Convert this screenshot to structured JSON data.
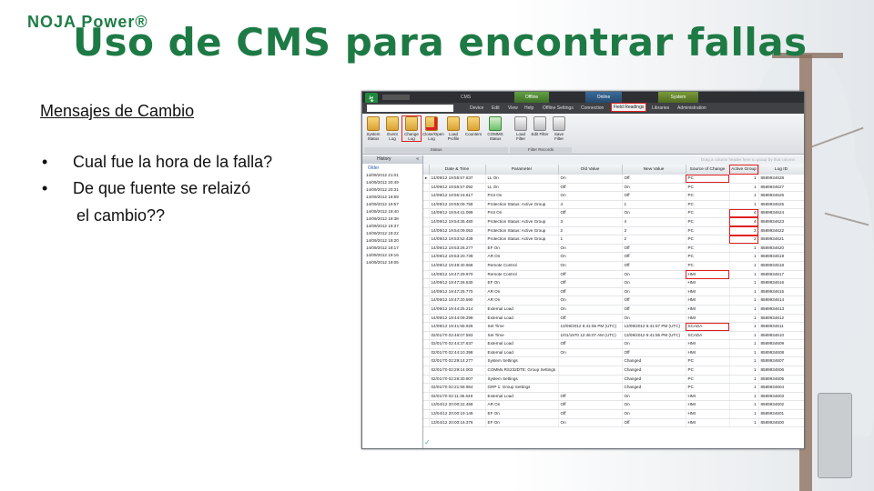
{
  "header": {
    "logo_text": "NOJA Power®",
    "title": "Uso de CMS para encontrar fallas"
  },
  "left": {
    "subhead": "Mensajes de Cambio",
    "bullets": [
      "Cual fue la hora de la falla?",
      "De que fuente se relaizó"
    ],
    "bullet_cont": "el cambio??"
  },
  "app": {
    "title": "CMS",
    "context_tabs": [
      "Offline",
      "Online",
      "System"
    ],
    "menu": [
      "Device",
      "Edit",
      "View",
      "Help",
      "Offline Settings",
      "Connection",
      "Field Readings",
      "Libraries",
      "Administration"
    ],
    "ribbon": [
      {
        "label": "System Status",
        "icon": "status-icon"
      },
      {
        "label": "Event Log",
        "icon": "event-log-icon"
      },
      {
        "label": "Change Log",
        "icon": "change-log-icon"
      },
      {
        "label": "Close/Open Log",
        "icon": "close-open-log-icon"
      },
      {
        "label": "Load Profile",
        "icon": "load-profile-icon"
      },
      {
        "label": "Counters",
        "icon": "counters-icon"
      },
      {
        "label": "COMMS Status",
        "icon": "comms-status-icon"
      },
      {
        "label": "Load Filter",
        "icon": "load-filter-icon"
      },
      {
        "label": "Edit Filter",
        "icon": "edit-filter-icon"
      },
      {
        "label": "Save Filter",
        "icon": "save-filter-icon"
      }
    ],
    "ribbon_groups": [
      "Status",
      "Filter Records"
    ],
    "history": {
      "title": "History",
      "collapse": "«",
      "older": "Older",
      "items": [
        "14/09/2012 21:01",
        "14/09/2012 20:49",
        "14/09/2012 20:31",
        "14/09/2012 19:59",
        "14/09/2012 19:57",
        "14/09/2012 19:40",
        "14/09/2012 19:38",
        "14/09/2012 19:37",
        "14/09/2012 19:22",
        "14/09/2012 19:20",
        "14/09/2012 19:17",
        "14/09/2012 19:16",
        "14/09/2012 19:05"
      ]
    },
    "drag_hint": "Drag a column header here to group by that column",
    "columns": [
      "Date & Time",
      "Parameter",
      "Old Value",
      "New Value",
      "Source of Change",
      "Active Group",
      "Log ID"
    ],
    "rows": [
      [
        "14/09/12 19:55:57.637",
        "LL On",
        "On",
        "Off",
        "PC",
        "1",
        "8589934628"
      ],
      [
        "14/09/12 19:55:57.092",
        "LL On",
        "Off",
        "On",
        "PC",
        "1",
        "8589934627"
      ],
      [
        "14/09/12 19:55:15.617",
        "Prot On",
        "On",
        "Off",
        "PC",
        "1",
        "8589934626"
      ],
      [
        "14/09/12 19:55:09.758",
        "Protection Status: Active Group",
        "4",
        "1",
        "PC",
        "1",
        "8589934625"
      ],
      [
        "14/09/12 19:54:41.099",
        "Prot On",
        "Off",
        "On",
        "PC",
        "4",
        "8589934624"
      ],
      [
        "14/09/12 19:54:35.480",
        "Protection Status: Active Group",
        "3",
        "4",
        "PC",
        "4",
        "8589934623"
      ],
      [
        "14/09/12 19:54:09.053",
        "Protection Status: Active Group",
        "2",
        "3",
        "PC",
        "3",
        "8589934622"
      ],
      [
        "14/09/12 19:53:52.439",
        "Protection Status: Active Group",
        "1",
        "2",
        "PC",
        "2",
        "8589934621"
      ],
      [
        "14/09/12 19:53:26.277",
        "EF On",
        "On",
        "Off",
        "PC",
        "1",
        "8589934620"
      ],
      [
        "14/09/12 19:53:20.739",
        "AR On",
        "On",
        "Off",
        "PC",
        "1",
        "8589934619"
      ],
      [
        "14/09/12 19:48:40.668",
        "Remote Control",
        "On",
        "Off",
        "PC",
        "1",
        "8589934618"
      ],
      [
        "14/09/12 19:47:29.970",
        "Remote Control",
        "Off",
        "On",
        "HMI",
        "1",
        "8589934617"
      ],
      [
        "14/09/12 19:47:26.530",
        "EF On",
        "Off",
        "On",
        "HMI",
        "1",
        "8589934616"
      ],
      [
        "14/09/12 19:47:25.770",
        "AR On",
        "Off",
        "On",
        "HMI",
        "1",
        "8589934615"
      ],
      [
        "14/09/12 19:47:20.590",
        "AR On",
        "On",
        "Off",
        "HMI",
        "1",
        "8589934614"
      ],
      [
        "14/09/12 19:44:25.214",
        "External Load",
        "On",
        "Off",
        "HMI",
        "1",
        "8589934613"
      ],
      [
        "14/09/12 19:44:09.299",
        "External Load",
        "Off",
        "On",
        "HMI",
        "1",
        "8589934612"
      ],
      [
        "14/09/12 19:41:55.926",
        "Set Time",
        "13/09/2012 6:41:55 PM (UTC)",
        "13/09/2012 6:41:57 PM (UTC)",
        "SCADA",
        "1",
        "8589934611"
      ],
      [
        "02/01/70 02:46:07.593",
        "Set Time",
        "1/01/1970 12:46:07 AM (UTC)",
        "13/09/2012 6:41:55 PM (UTC)",
        "SCADA",
        "1",
        "8589934610"
      ],
      [
        "02/01/70 02:44:37.637",
        "External Load",
        "Off",
        "On",
        "HMI",
        "1",
        "8589934609"
      ],
      [
        "02/01/70 02:44:10.398",
        "External Load",
        "On",
        "Off",
        "HMI",
        "1",
        "8589934608"
      ],
      [
        "02/01/70 02:29:14.277",
        "System Settings",
        "",
        "Changed",
        "PC",
        "1",
        "8589934607"
      ],
      [
        "02/01/70 02:29:14.003",
        "COMMs RS232DTE: Group Settings",
        "",
        "Changed",
        "PC",
        "1",
        "8589934606"
      ],
      [
        "02/01/70 02:28:30.807",
        "System Settings",
        "",
        "Changed",
        "PC",
        "1",
        "8589934605"
      ],
      [
        "02/01/70 02:21:56.954",
        "GRP 1: Group Settings",
        "",
        "Changed",
        "PC",
        "1",
        "8589934604"
      ],
      [
        "02/01/70 02:11:35.649",
        "External Load",
        "Off",
        "On",
        "HMI",
        "1",
        "8589934603"
      ],
      [
        "13/04/12 20:00:22.458",
        "AR On",
        "Off",
        "On",
        "HMI",
        "1",
        "8589934602"
      ],
      [
        "13/04/12 20:00:19.149",
        "EF On",
        "Off",
        "On",
        "HMI",
        "1",
        "8589934601"
      ],
      [
        "13/04/12 20:00:16.376",
        "EF On",
        "On",
        "Off",
        "HMI",
        "1",
        "8589934600"
      ]
    ]
  }
}
